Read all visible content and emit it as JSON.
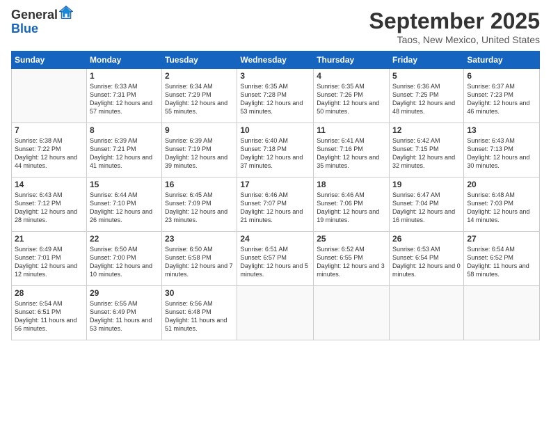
{
  "logo": {
    "general": "General",
    "blue": "Blue"
  },
  "title": "September 2025",
  "location": "Taos, New Mexico, United States",
  "weekdays": [
    "Sunday",
    "Monday",
    "Tuesday",
    "Wednesday",
    "Thursday",
    "Friday",
    "Saturday"
  ],
  "weeks": [
    [
      {
        "day": "",
        "sunrise": "",
        "sunset": "",
        "daylight": ""
      },
      {
        "day": "1",
        "sunrise": "Sunrise: 6:33 AM",
        "sunset": "Sunset: 7:31 PM",
        "daylight": "Daylight: 12 hours and 57 minutes."
      },
      {
        "day": "2",
        "sunrise": "Sunrise: 6:34 AM",
        "sunset": "Sunset: 7:29 PM",
        "daylight": "Daylight: 12 hours and 55 minutes."
      },
      {
        "day": "3",
        "sunrise": "Sunrise: 6:35 AM",
        "sunset": "Sunset: 7:28 PM",
        "daylight": "Daylight: 12 hours and 53 minutes."
      },
      {
        "day": "4",
        "sunrise": "Sunrise: 6:35 AM",
        "sunset": "Sunset: 7:26 PM",
        "daylight": "Daylight: 12 hours and 50 minutes."
      },
      {
        "day": "5",
        "sunrise": "Sunrise: 6:36 AM",
        "sunset": "Sunset: 7:25 PM",
        "daylight": "Daylight: 12 hours and 48 minutes."
      },
      {
        "day": "6",
        "sunrise": "Sunrise: 6:37 AM",
        "sunset": "Sunset: 7:23 PM",
        "daylight": "Daylight: 12 hours and 46 minutes."
      }
    ],
    [
      {
        "day": "7",
        "sunrise": "Sunrise: 6:38 AM",
        "sunset": "Sunset: 7:22 PM",
        "daylight": "Daylight: 12 hours and 44 minutes."
      },
      {
        "day": "8",
        "sunrise": "Sunrise: 6:39 AM",
        "sunset": "Sunset: 7:21 PM",
        "daylight": "Daylight: 12 hours and 41 minutes."
      },
      {
        "day": "9",
        "sunrise": "Sunrise: 6:39 AM",
        "sunset": "Sunset: 7:19 PM",
        "daylight": "Daylight: 12 hours and 39 minutes."
      },
      {
        "day": "10",
        "sunrise": "Sunrise: 6:40 AM",
        "sunset": "Sunset: 7:18 PM",
        "daylight": "Daylight: 12 hours and 37 minutes."
      },
      {
        "day": "11",
        "sunrise": "Sunrise: 6:41 AM",
        "sunset": "Sunset: 7:16 PM",
        "daylight": "Daylight: 12 hours and 35 minutes."
      },
      {
        "day": "12",
        "sunrise": "Sunrise: 6:42 AM",
        "sunset": "Sunset: 7:15 PM",
        "daylight": "Daylight: 12 hours and 32 minutes."
      },
      {
        "day": "13",
        "sunrise": "Sunrise: 6:43 AM",
        "sunset": "Sunset: 7:13 PM",
        "daylight": "Daylight: 12 hours and 30 minutes."
      }
    ],
    [
      {
        "day": "14",
        "sunrise": "Sunrise: 6:43 AM",
        "sunset": "Sunset: 7:12 PM",
        "daylight": "Daylight: 12 hours and 28 minutes."
      },
      {
        "day": "15",
        "sunrise": "Sunrise: 6:44 AM",
        "sunset": "Sunset: 7:10 PM",
        "daylight": "Daylight: 12 hours and 26 minutes."
      },
      {
        "day": "16",
        "sunrise": "Sunrise: 6:45 AM",
        "sunset": "Sunset: 7:09 PM",
        "daylight": "Daylight: 12 hours and 23 minutes."
      },
      {
        "day": "17",
        "sunrise": "Sunrise: 6:46 AM",
        "sunset": "Sunset: 7:07 PM",
        "daylight": "Daylight: 12 hours and 21 minutes."
      },
      {
        "day": "18",
        "sunrise": "Sunrise: 6:46 AM",
        "sunset": "Sunset: 7:06 PM",
        "daylight": "Daylight: 12 hours and 19 minutes."
      },
      {
        "day": "19",
        "sunrise": "Sunrise: 6:47 AM",
        "sunset": "Sunset: 7:04 PM",
        "daylight": "Daylight: 12 hours and 16 minutes."
      },
      {
        "day": "20",
        "sunrise": "Sunrise: 6:48 AM",
        "sunset": "Sunset: 7:03 PM",
        "daylight": "Daylight: 12 hours and 14 minutes."
      }
    ],
    [
      {
        "day": "21",
        "sunrise": "Sunrise: 6:49 AM",
        "sunset": "Sunset: 7:01 PM",
        "daylight": "Daylight: 12 hours and 12 minutes."
      },
      {
        "day": "22",
        "sunrise": "Sunrise: 6:50 AM",
        "sunset": "Sunset: 7:00 PM",
        "daylight": "Daylight: 12 hours and 10 minutes."
      },
      {
        "day": "23",
        "sunrise": "Sunrise: 6:50 AM",
        "sunset": "Sunset: 6:58 PM",
        "daylight": "Daylight: 12 hours and 7 minutes."
      },
      {
        "day": "24",
        "sunrise": "Sunrise: 6:51 AM",
        "sunset": "Sunset: 6:57 PM",
        "daylight": "Daylight: 12 hours and 5 minutes."
      },
      {
        "day": "25",
        "sunrise": "Sunrise: 6:52 AM",
        "sunset": "Sunset: 6:55 PM",
        "daylight": "Daylight: 12 hours and 3 minutes."
      },
      {
        "day": "26",
        "sunrise": "Sunrise: 6:53 AM",
        "sunset": "Sunset: 6:54 PM",
        "daylight": "Daylight: 12 hours and 0 minutes."
      },
      {
        "day": "27",
        "sunrise": "Sunrise: 6:54 AM",
        "sunset": "Sunset: 6:52 PM",
        "daylight": "Daylight: 11 hours and 58 minutes."
      }
    ],
    [
      {
        "day": "28",
        "sunrise": "Sunrise: 6:54 AM",
        "sunset": "Sunset: 6:51 PM",
        "daylight": "Daylight: 11 hours and 56 minutes."
      },
      {
        "day": "29",
        "sunrise": "Sunrise: 6:55 AM",
        "sunset": "Sunset: 6:49 PM",
        "daylight": "Daylight: 11 hours and 53 minutes."
      },
      {
        "day": "30",
        "sunrise": "Sunrise: 6:56 AM",
        "sunset": "Sunset: 6:48 PM",
        "daylight": "Daylight: 11 hours and 51 minutes."
      },
      {
        "day": "",
        "sunrise": "",
        "sunset": "",
        "daylight": ""
      },
      {
        "day": "",
        "sunrise": "",
        "sunset": "",
        "daylight": ""
      },
      {
        "day": "",
        "sunrise": "",
        "sunset": "",
        "daylight": ""
      },
      {
        "day": "",
        "sunrise": "",
        "sunset": "",
        "daylight": ""
      }
    ]
  ]
}
